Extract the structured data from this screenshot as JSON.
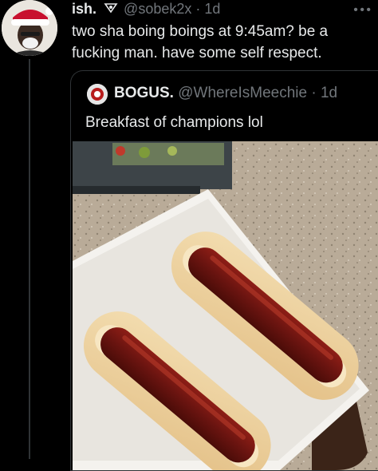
{
  "tweet": {
    "name": "ish.",
    "handle": "@sobek2x",
    "separator": "·",
    "time": "1d",
    "text": "two sha boing boings at 9:45am? be a fucking man. have some self respect.",
    "more_icon": "more-icon"
  },
  "quote": {
    "name": "BOGUS.",
    "handle": "@WhereIsMeechie",
    "separator": "·",
    "time": "1d",
    "text": "Breakfast of champions lol"
  },
  "colors": {
    "background": "#000000",
    "text": "#e7e9ea",
    "muted": "#71767b",
    "border": "#2f3336"
  }
}
